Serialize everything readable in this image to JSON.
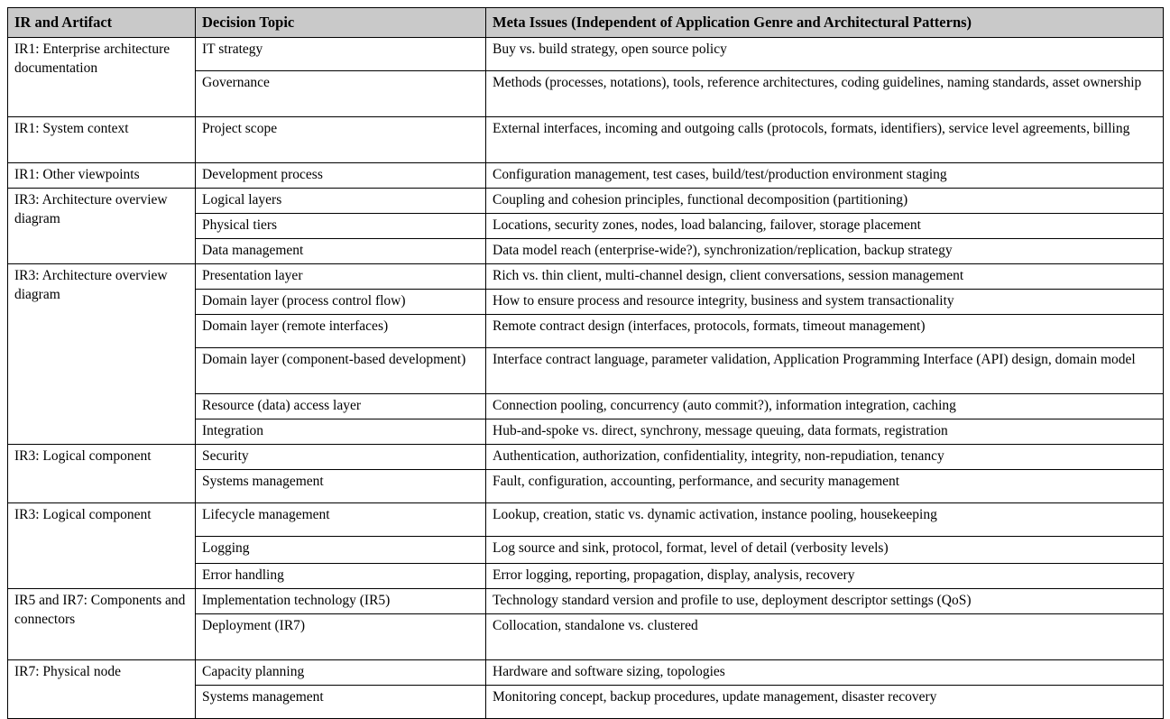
{
  "document": {
    "type": "table",
    "background_color": "#ffffff",
    "text_color": "#000000",
    "header_background_color": "#c9c9c9",
    "border_color": "#000000"
  },
  "table": {
    "headers": [
      "IR and Artifact",
      "Decision Topic",
      "Meta Issues (Independent of Application Genre and Architectural Patterns)"
    ],
    "groups": [
      {
        "ir_artifact": "IR1: Enterprise architecture documentation",
        "rows": [
          {
            "topic": "IT strategy",
            "meta": "Buy vs. build strategy, open source policy"
          },
          {
            "topic": "Governance",
            "meta": "Methods (processes, notations), tools, reference architectures, coding guidelines, naming standards, asset ownership"
          }
        ]
      },
      {
        "ir_artifact": "IR1: System context",
        "rows": [
          {
            "topic": "Project scope",
            "meta": "External interfaces, incoming and outgoing calls (protocols, formats, identifiers), service level agreements, billing"
          }
        ]
      },
      {
        "ir_artifact": "IR1: Other viewpoints",
        "rows": [
          {
            "topic": "Development process",
            "meta": "Configuration management, test cases, build/test/production environment staging"
          }
        ]
      },
      {
        "ir_artifact": "IR3: Architecture overview diagram",
        "rows": [
          {
            "topic": "Logical layers",
            "meta": "Coupling and cohesion principles, functional decomposition (partitioning)"
          },
          {
            "topic": "Physical tiers",
            "meta": "Locations, security zones, nodes, load balancing, failover, storage placement"
          },
          {
            "topic": "Data management",
            "meta": "Data model reach (enterprise-wide?), synchronization/replication, backup strategy"
          }
        ]
      },
      {
        "ir_artifact": "IR3: Architecture overview diagram",
        "rows": [
          {
            "topic": "Presentation layer",
            "meta": "Rich vs. thin client, multi-channel design, client conversations, session management"
          },
          {
            "topic": "Domain layer (process control flow)",
            "meta": "How to ensure process and resource integrity, business and system transactionality"
          },
          {
            "topic": "Domain layer (remote interfaces)",
            "meta": "Remote contract design (interfaces, protocols, formats, timeout management)"
          },
          {
            "topic": "Domain layer (component-based development)",
            "meta": "Interface contract language, parameter validation, Application Programming Interface (API) design, domain model"
          },
          {
            "topic": "Resource (data) access layer",
            "meta": "Connection pooling, concurrency (auto commit?), information integration, caching"
          },
          {
            "topic": "Integration",
            "meta": "Hub-and-spoke vs. direct, synchrony, message queuing, data formats, registration"
          }
        ]
      },
      {
        "ir_artifact": "IR3: Logical component",
        "rows": [
          {
            "topic": "Security",
            "meta": "Authentication, authorization, confidentiality, integrity, non-repudiation, tenancy"
          },
          {
            "topic": "Systems management",
            "meta": "Fault, configuration, accounting, performance, and security management"
          }
        ]
      },
      {
        "ir_artifact": "IR3: Logical component",
        "rows": [
          {
            "topic": "Lifecycle management",
            "meta": "Lookup, creation, static vs. dynamic activation, instance pooling, housekeeping"
          },
          {
            "topic": "Logging",
            "meta": "Log source and sink, protocol, format, level of detail (verbosity levels)"
          },
          {
            "topic": "Error handling",
            "meta": "Error logging, reporting, propagation, display, analysis, recovery"
          }
        ]
      },
      {
        "ir_artifact": "IR5 and IR7: Components and connectors",
        "rows": [
          {
            "topic": "Implementation technology (IR5)",
            "meta": "Technology standard version and profile to use, deployment descriptor settings (QoS)"
          },
          {
            "topic": "Deployment  (IR7)",
            "meta": "Collocation, standalone vs. clustered"
          }
        ]
      },
      {
        "ir_artifact": "IR7: Physical node",
        "rows": [
          {
            "topic": "Capacity planning",
            "meta": "Hardware and software sizing, topologies"
          },
          {
            "topic": "Systems management",
            "meta": "Monitoring concept, backup procedures, update management, disaster recovery"
          }
        ]
      }
    ]
  }
}
